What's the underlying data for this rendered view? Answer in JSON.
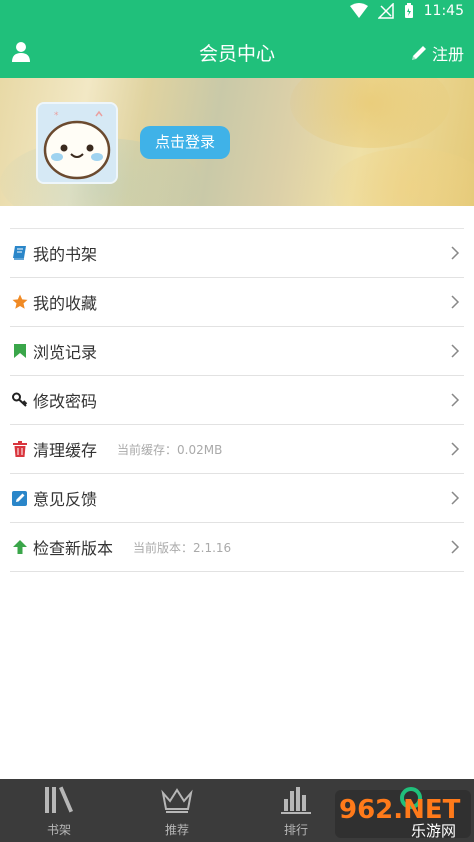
{
  "status_bar": {
    "time": "11:45"
  },
  "header": {
    "title": "会员中心",
    "register_label": "注册"
  },
  "banner": {
    "login_label": "点击登录"
  },
  "menu": [
    {
      "label": "我的书架",
      "sub": "",
      "icon": "book-icon",
      "color": "#2a86c9"
    },
    {
      "label": "我的收藏",
      "sub": "",
      "icon": "star-icon",
      "color": "#f08a24"
    },
    {
      "label": "浏览记录",
      "sub": "",
      "icon": "bookmark-icon",
      "color": "#3aa64a"
    },
    {
      "label": "修改密码",
      "sub": "",
      "icon": "key-icon",
      "color": "#222222"
    },
    {
      "label": "清理缓存",
      "sub": "当前缓存：0.02MB",
      "icon": "trash-icon",
      "color": "#d9363e"
    },
    {
      "label": "意见反馈",
      "sub": "",
      "icon": "edit-icon",
      "color": "#2a86c9"
    },
    {
      "label": "检查新版本",
      "sub": "当前版本：2.1.16",
      "icon": "arrow-up-icon",
      "color": "#3aa64a"
    }
  ],
  "tabs": [
    {
      "label": "书架",
      "icon": "bookshelf-icon"
    },
    {
      "label": "推荐",
      "icon": "crown-icon"
    },
    {
      "label": "排行",
      "icon": "bar-chart-icon"
    }
  ],
  "watermark": {
    "text_top": "962.NET",
    "text_bottom": "乐游网"
  },
  "colors": {
    "primary": "#20c07b",
    "login_button": "#3fb2e8",
    "tabbar": "#3b3b3b"
  }
}
